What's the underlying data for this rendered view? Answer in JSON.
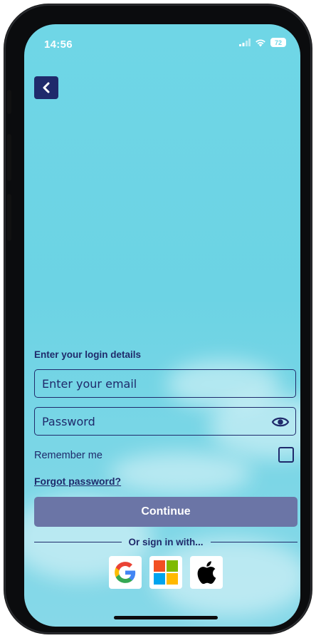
{
  "status_bar": {
    "time": "14:56",
    "battery": "72"
  },
  "nav": {
    "back_icon": "chevron-left-icon"
  },
  "login": {
    "section_title": "Enter your login details",
    "email_placeholder": "Enter your email",
    "password_placeholder": "Password",
    "remember_label": "Remember me",
    "forgot_label": "Forgot password?",
    "continue_label": "Continue",
    "divider_text": "Or sign in with..."
  },
  "social": [
    {
      "name": "google-icon"
    },
    {
      "name": "microsoft-icon"
    },
    {
      "name": "apple-icon"
    }
  ],
  "colors": {
    "primary": "#1f2a6b",
    "button": "#6b75a6",
    "sky": "#6fd6e6"
  }
}
